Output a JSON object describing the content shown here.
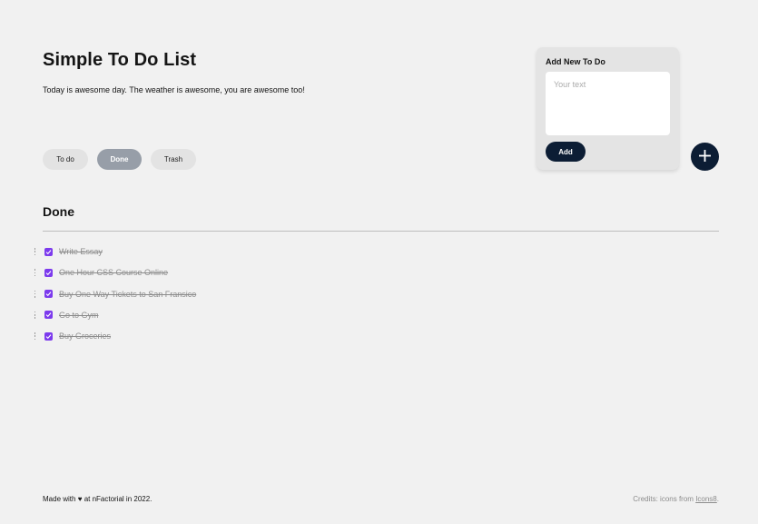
{
  "header": {
    "title": "Simple To Do List",
    "subtitle": "Today is awesome day. The weather is awesome, you are awesome too!"
  },
  "tabs": [
    {
      "label": "To do",
      "active": false
    },
    {
      "label": "Done",
      "active": true
    },
    {
      "label": "Trash",
      "active": false
    }
  ],
  "add_card": {
    "title": "Add New To Do",
    "placeholder": "Your text",
    "value": "",
    "button_label": "Add"
  },
  "fab": {
    "icon": "plus-icon"
  },
  "section": {
    "title": "Done"
  },
  "items": [
    {
      "text": "Write Essay",
      "done": true
    },
    {
      "text": "One Hour CSS Course Online",
      "done": true
    },
    {
      "text": "Buy One Way Tickets to San Fransico",
      "done": true
    },
    {
      "text": "Go to Gym",
      "done": true
    },
    {
      "text": "Buy Groceries",
      "done": true
    }
  ],
  "footer": {
    "made_prefix": "Made with",
    "heart": "♥",
    "made_suffix": "at nFactorial in 2022.",
    "credits_prefix": "Credits: icons from",
    "credits_link": "Icons8",
    "credits_suffix": "."
  },
  "colors": {
    "background": "#f1f1f1",
    "accent_dark": "#0c1d34",
    "checkbox": "#7c3aed",
    "active_tab": "#979ea8"
  }
}
